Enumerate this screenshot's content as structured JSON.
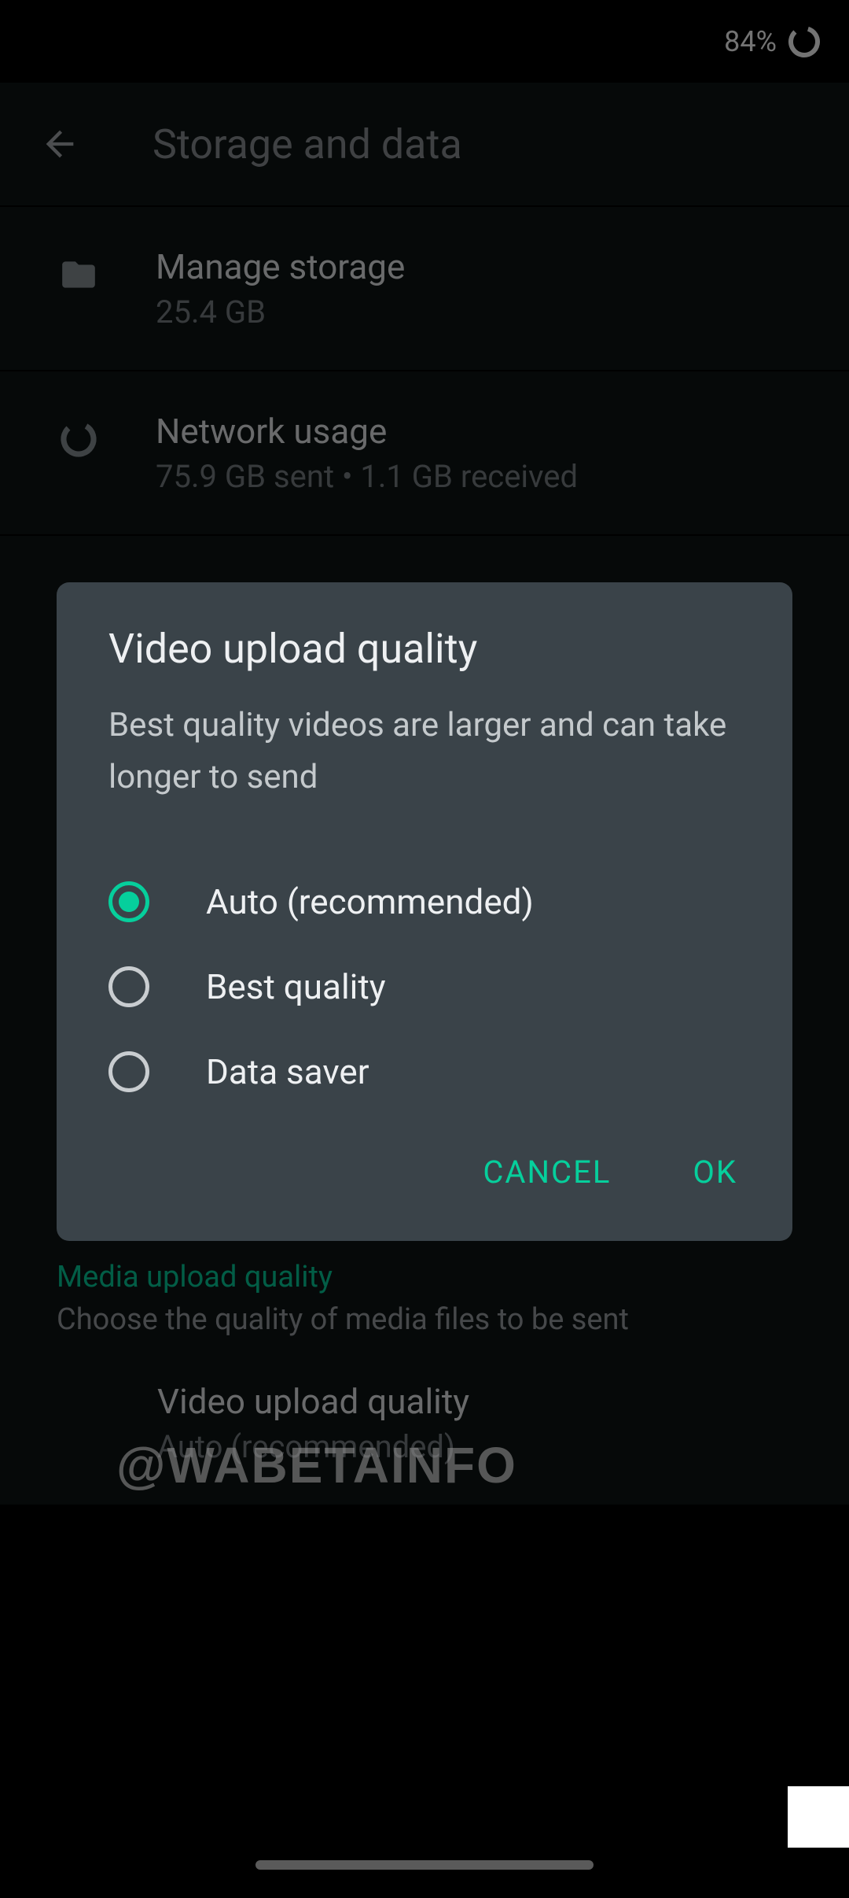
{
  "status": {
    "battery_percent": "84%"
  },
  "appbar": {
    "title": "Storage and data"
  },
  "items": {
    "manage_storage": {
      "title": "Manage storage",
      "subtitle": "25.4 GB"
    },
    "network_usage": {
      "title": "Network usage",
      "subtitle": "75.9 GB sent • 1.1 GB received"
    },
    "video_upload_quality": {
      "title": "Video upload quality",
      "subtitle": "Auto (recommended)"
    }
  },
  "section": {
    "title": "Media upload quality",
    "desc": "Choose the quality of media files to be sent"
  },
  "dialog": {
    "title": "Video upload quality",
    "description": "Best quality videos are larger and can take longer to send",
    "options": {
      "auto": "Auto (recommended)",
      "best": "Best quality",
      "saver": "Data saver"
    },
    "selected": "auto",
    "cancel": "CANCEL",
    "ok": "OK"
  },
  "watermark": "@WABETAINFO"
}
